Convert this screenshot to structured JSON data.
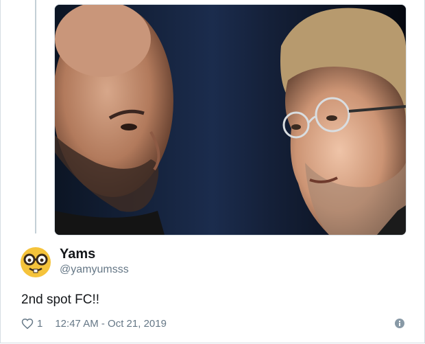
{
  "tweet": {
    "display_name": "Yams",
    "handle": "@yamyumsss",
    "text": "2nd spot FC!!",
    "like_count": "1",
    "timestamp": "12:47 AM - Oct 21, 2019"
  },
  "icons": {
    "avatar": "nerd-face-emoji",
    "like": "heart-icon",
    "info": "info-icon"
  },
  "colors": {
    "text_primary": "#14171a",
    "text_secondary": "#657786",
    "thread_line": "#c4cfd6",
    "emoji_yellow": "#f5c33b"
  }
}
